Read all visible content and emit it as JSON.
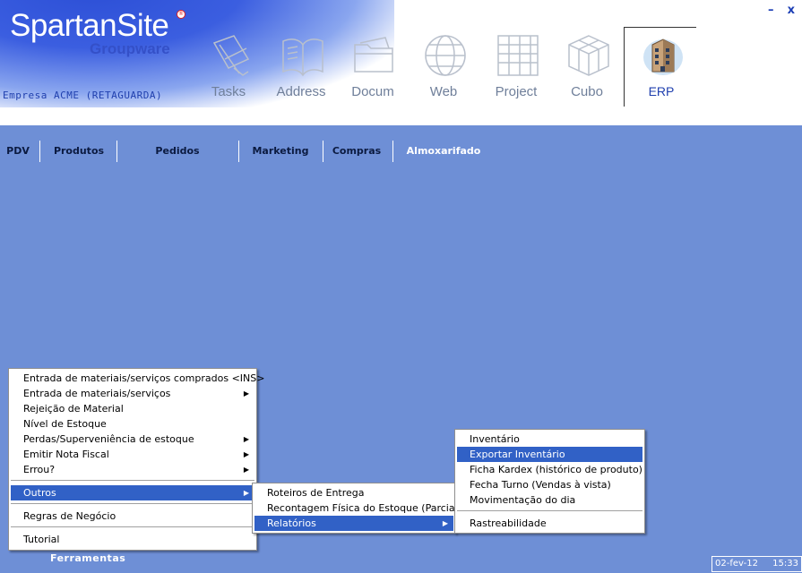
{
  "brand": {
    "title": "SpartanSite",
    "reg": "®",
    "subtitle": "Groupware",
    "company": "Empresa ACME (RETAGUARDA)"
  },
  "window": {
    "minimize": "–",
    "close": "x"
  },
  "apps": [
    {
      "label": "Tasks",
      "icon": "tasks-icon"
    },
    {
      "label": "Address",
      "icon": "address-book-icon"
    },
    {
      "label": "Docum",
      "icon": "folder-icon"
    },
    {
      "label": "Web",
      "icon": "globe-icon"
    },
    {
      "label": "Project",
      "icon": "project-icon"
    },
    {
      "label": "Cubo",
      "icon": "cube-icon"
    },
    {
      "label": "ERP",
      "icon": "building-icon"
    }
  ],
  "modules": [
    "PDV",
    "Produtos",
    "Pedidos",
    "Marketing",
    "Compras",
    "Almoxarifado"
  ],
  "menu_main": [
    {
      "label": "Entrada de materiais/serviços comprados <INS>"
    },
    {
      "label": "Entrada de materiais/serviços",
      "arrow": "▶"
    },
    {
      "label": "Rejeição de Material"
    },
    {
      "label": "Nível de Estoque"
    },
    {
      "label": "Perdas/Superveniência de estoque",
      "arrow": "▶"
    },
    {
      "label": "Emitir Nota Fiscal",
      "arrow": "▶"
    },
    {
      "label": "Errou?",
      "arrow": "▶"
    },
    {
      "label": "Outros",
      "arrow": "▶"
    },
    {
      "label": "Regras de Negócio"
    },
    {
      "label": "Tutorial"
    }
  ],
  "menu_outros": [
    {
      "label": "Roteiros de Entrega"
    },
    {
      "label": "Recontagem Física do Estoque (Parcial)"
    },
    {
      "label": "Relatórios",
      "arrow": "▶"
    }
  ],
  "menu_relatorios": [
    {
      "label": "Inventário"
    },
    {
      "label": "Exportar Inventário"
    },
    {
      "label": "Ficha Kardex (histórico de produto)"
    },
    {
      "label": "Fecha Turno (Vendas à vista)"
    },
    {
      "label": "Movimentação do dia"
    },
    {
      "label": "Rastreabilidade"
    }
  ],
  "footer": {
    "tools": "Ferramentas",
    "date": "02-fev-12",
    "time": "15:33"
  }
}
